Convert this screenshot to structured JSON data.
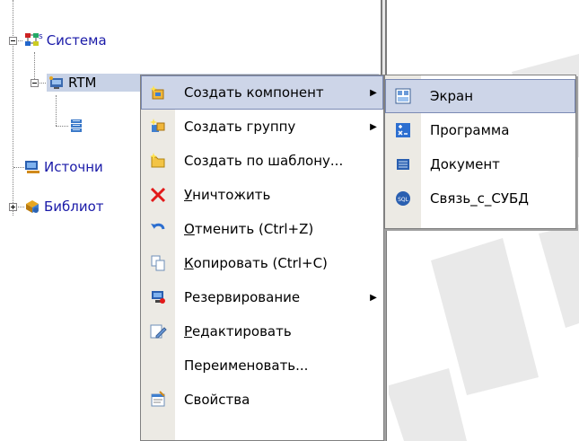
{
  "tree": {
    "root": {
      "label": "Система",
      "icon": "network-icon"
    },
    "rtm": {
      "label": "RTM",
      "icon": "rtm-node-icon"
    },
    "child": {
      "icon": "server-icon"
    },
    "sources": {
      "label": "Источни",
      "icon": "data-source-icon"
    },
    "library": {
      "label": "Библиот",
      "icon": "library-icon"
    }
  },
  "context_menu": {
    "items": [
      {
        "label": "Создать компонент",
        "icon": "create-component-icon",
        "submenu": true,
        "highlighted": true
      },
      {
        "label": "Создать группу",
        "icon": "create-group-icon",
        "submenu": true
      },
      {
        "label": "Создать по шаблону...",
        "icon": "create-from-template-icon"
      },
      {
        "label_u": "У",
        "label_rest": "ничтожить",
        "icon": "delete-x-icon"
      },
      {
        "label_u": "О",
        "label_rest": "тменить (Ctrl+Z)",
        "icon": "undo-icon"
      },
      {
        "label_u": "К",
        "label_rest": "опировать (Ctrl+C)",
        "icon": "copy-icon"
      },
      {
        "label": "Резервирование",
        "icon": "backup-icon",
        "submenu": true
      },
      {
        "label_u": "Р",
        "label_rest": "едактировать",
        "icon": "edit-icon"
      },
      {
        "label": "Переименовать...",
        "icon": ""
      },
      {
        "label": "Свойства",
        "icon": "properties-icon"
      }
    ]
  },
  "component_submenu": {
    "items": [
      {
        "label": "Экран",
        "icon": "screen-icon",
        "highlighted": true
      },
      {
        "label": "Программа",
        "icon": "program-icon"
      },
      {
        "label": "Документ",
        "icon": "document-icon"
      },
      {
        "label": "Связь_с_СУБД",
        "icon": "sql-icon"
      }
    ]
  },
  "colors": {
    "tree_link": "#1a1aa8",
    "selection": "#c8d2e6",
    "menu_highlight": "#cdd5e8",
    "menu_gutter": "#eceae4",
    "watermark": "#e8e8e8"
  }
}
